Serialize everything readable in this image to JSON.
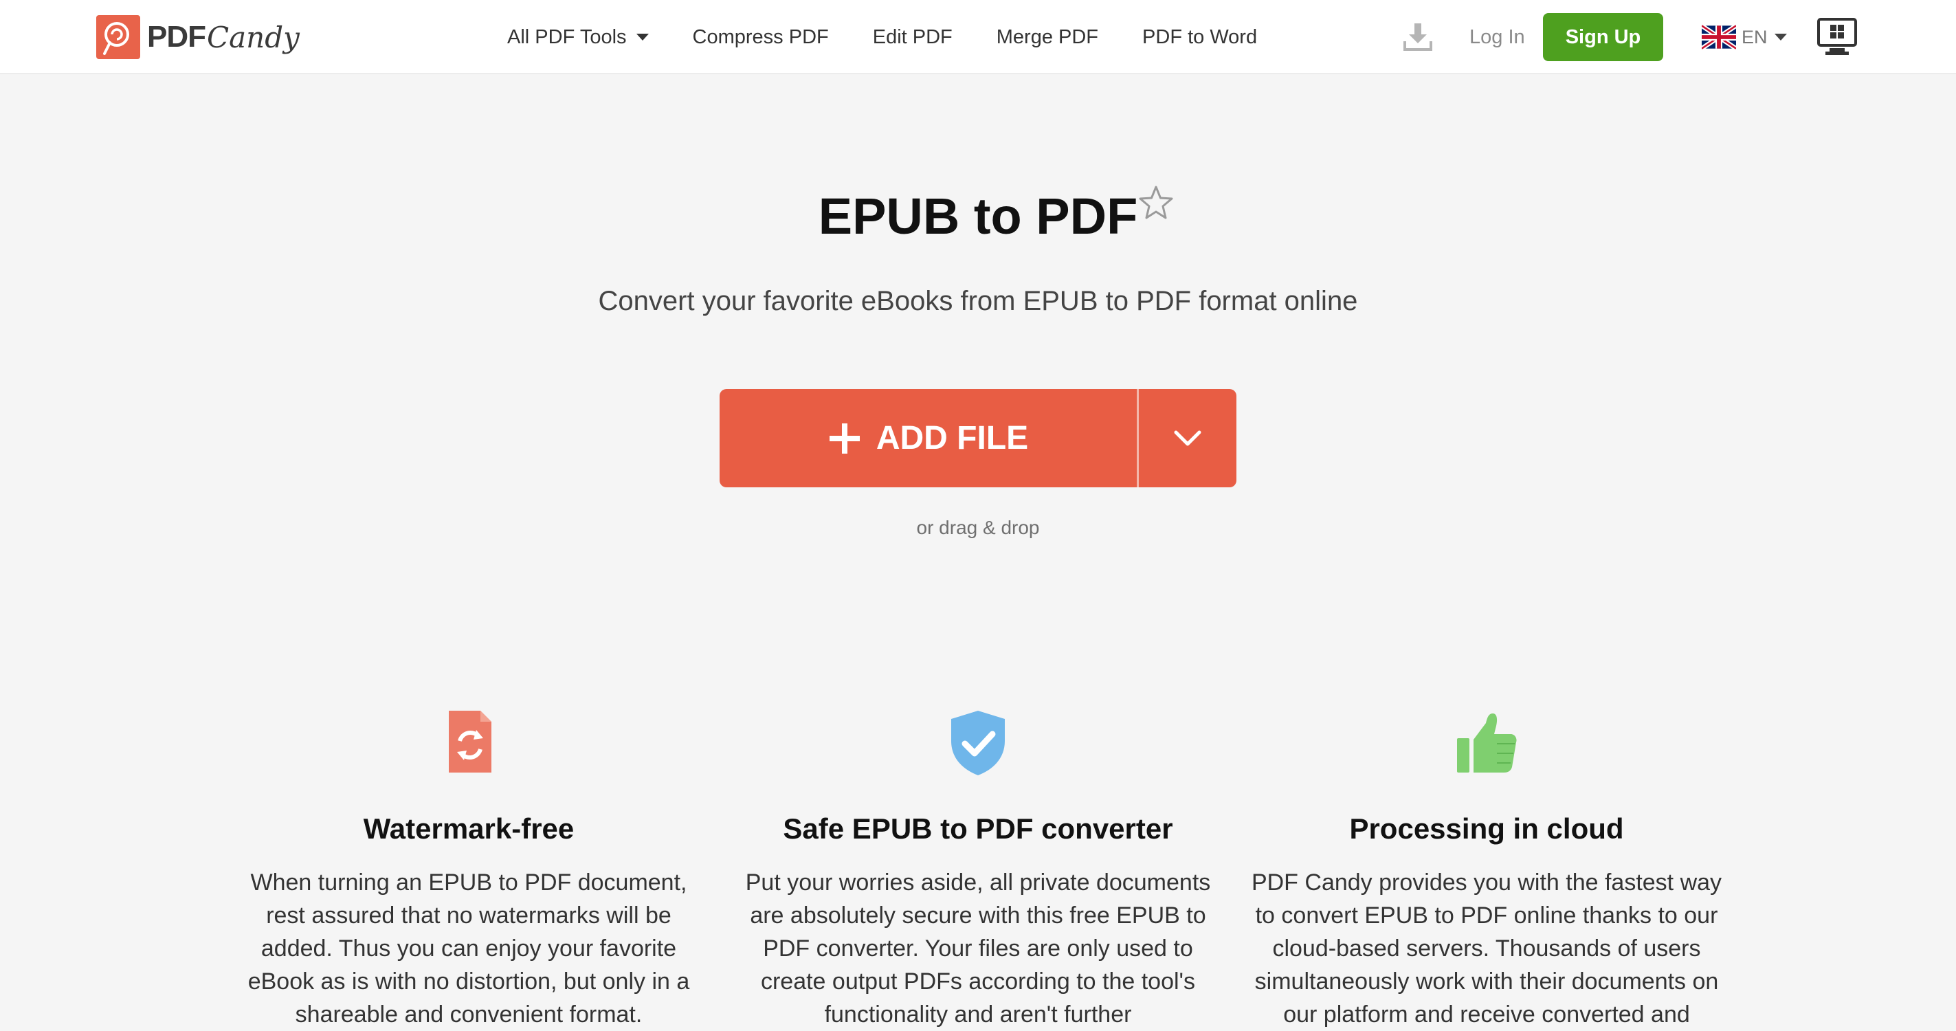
{
  "brand": {
    "pdf": "PDF",
    "candy": "Candy"
  },
  "nav": {
    "all_tools": "All PDF Tools",
    "compress": "Compress PDF",
    "edit": "Edit PDF",
    "merge": "Merge PDF",
    "pdf_to_word": "PDF to Word"
  },
  "account": {
    "login": "Log In",
    "signup": "Sign Up",
    "language": "EN"
  },
  "hero": {
    "title": "EPUB to PDF",
    "subtitle": "Convert your favorite eBooks from EPUB to PDF format online",
    "add_file": "ADD FILE",
    "drag_drop": "or drag & drop"
  },
  "features": [
    {
      "icon": "file-refresh-icon",
      "title": "Watermark-free",
      "text": "When turning an EPUB to PDF document, rest assured that no watermarks will be added. Thus you can enjoy your favorite eBook as is with no distortion, but only in a shareable and convenient format."
    },
    {
      "icon": "shield-check-icon",
      "title": "Safe EPUB to PDF converter",
      "text": "Put your worries aside, all private documents are absolutely secure with this free EPUB to PDF converter. Your files are only used to create output PDFs according to the tool's functionality and aren't further"
    },
    {
      "icon": "thumbs-up-icon",
      "title": "Processing in cloud",
      "text": "PDF Candy provides you with the fastest way to convert EPUB to PDF online thanks to our cloud-based servers. Thousands of users simultaneously work with their documents on our platform and receive converted and"
    }
  ],
  "colors": {
    "accent": "#e85d44",
    "signup": "#4ea01f",
    "shield": "#6fb6ea",
    "thumb": "#7fcf6f",
    "file_icon": "#ec7a66",
    "background": "#f5f5f5"
  }
}
